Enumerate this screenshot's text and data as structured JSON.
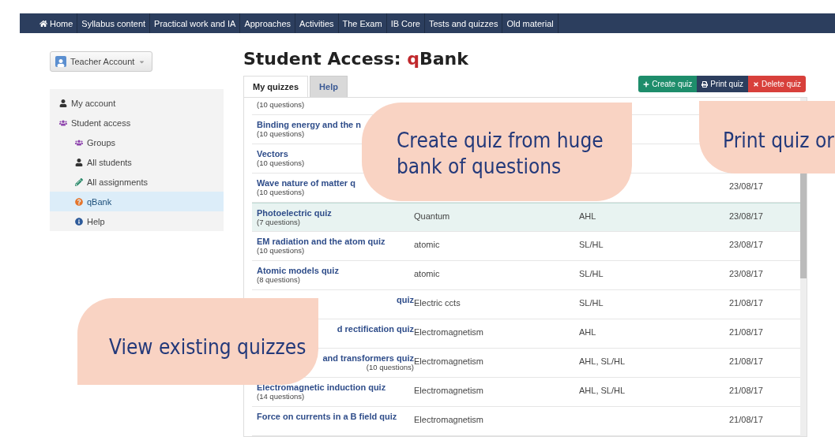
{
  "nav": [
    {
      "label": "Home",
      "kind": "home"
    },
    {
      "label": "Syllabus content",
      "kind": "link"
    },
    {
      "label": "Practical work and IA",
      "kind": "link"
    },
    {
      "label": "Approaches",
      "kind": "link"
    },
    {
      "label": "Activities",
      "kind": "link"
    },
    {
      "label": "The Exam",
      "kind": "link"
    },
    {
      "label": "IB Core",
      "kind": "link"
    },
    {
      "label": "Tests and quizzes",
      "kind": "link"
    },
    {
      "label": "Old material",
      "kind": "link"
    }
  ],
  "account_button": "Teacher Account",
  "sidebar": {
    "items": [
      {
        "label": "My account",
        "kind": "account",
        "selected": false
      },
      {
        "label": "Student access",
        "kind": "access",
        "selected": false,
        "children": [
          {
            "label": "Groups",
            "kind": "groups",
            "selected": false
          },
          {
            "label": "All students",
            "kind": "students",
            "selected": false
          },
          {
            "label": "All assignments",
            "kind": "assignments",
            "selected": false
          },
          {
            "label": "qBank",
            "kind": "qbank",
            "selected": true
          },
          {
            "label": "Help",
            "kind": "help",
            "selected": false
          }
        ]
      }
    ]
  },
  "page_title": "Student Access: **q**Bank",
  "tabs": [
    {
      "label": "My quizzes",
      "selected": true
    },
    {
      "label": "Help",
      "selected": false
    }
  ],
  "actions": [
    {
      "label": "Create quiz",
      "kind": "create"
    },
    {
      "label": "Print quiz",
      "kind": "print"
    },
    {
      "label": "Delete quiz",
      "kind": "delete"
    }
  ],
  "rows": [
    {
      "count": "(10 questions)",
      "selected": false
    },
    {
      "title": "Binding energy and the n",
      "count": "(10 questions)",
      "selected": false
    },
    {
      "title": "Vectors",
      "count": "(10 questions)",
      "selected": false
    },
    {
      "title": "Wave nature of matter q",
      "count": "(10 questions)",
      "date": "23/08/17",
      "selected": false
    },
    {
      "title": "Photoelectric quiz",
      "count": "(7 questions)",
      "topic": "Quantum",
      "level": "AHL",
      "date": "23/08/17",
      "selected": true
    },
    {
      "title": "EM radiation and the atom quiz",
      "count": "(10 questions)",
      "topic": "atomic",
      "level": "SL/HL",
      "date": "23/08/17",
      "selected": false
    },
    {
      "title": "Atomic models quiz",
      "count": "(8 questions)",
      "topic": "atomic",
      "level": "SL/HL",
      "date": "23/08/17",
      "selected": false
    },
    {
      "title": "quiz",
      "title_covered": true,
      "topic": "Electric ccts",
      "level": "SL/HL",
      "date": "21/08/17",
      "selected": false
    },
    {
      "title": "d rectification quiz",
      "title_covered": true,
      "topic": "Electromagnetism",
      "level": "AHL",
      "date": "21/08/17",
      "selected": false
    },
    {
      "title": "and transformers quiz",
      "title_covered": true,
      "count": "(10 questions)",
      "topic": "Electromagnetism",
      "level": "AHL, SL/HL",
      "date": "21/08/17",
      "selected": false
    },
    {
      "title": "Electromagnetic induction quiz",
      "count": "(14 questions)",
      "topic": "Electromagnetism",
      "level": "AHL, SL/HL",
      "date": "21/08/17",
      "selected": false
    },
    {
      "title": "Force on currents in a B field quiz",
      "topic": "Electromagnetism",
      "date": "21/08/17",
      "selected": false
    }
  ],
  "callouts": [
    {
      "kind": "create",
      "text": "Create quiz from huge bank of questions"
    },
    {
      "kind": "print",
      "text": "Print quiz or"
    },
    {
      "kind": "view",
      "text": "View existing quizzes"
    }
  ]
}
